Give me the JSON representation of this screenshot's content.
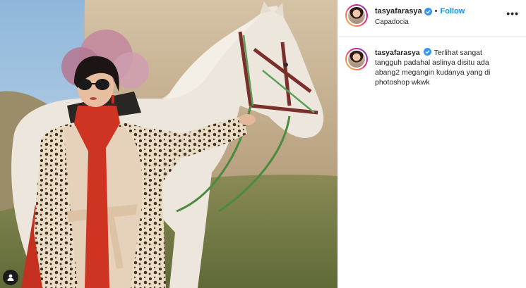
{
  "post": {
    "author": {
      "username": "tasyafarasya",
      "verified": true,
      "location": "Capadocia"
    },
    "follow_label": "Follow",
    "separator": "•",
    "more_label": "•••",
    "caption": {
      "username": "tasyafarasya",
      "text": "Terlihat sangat tangguh padahal aslinya disitu ada abang2 megangin kudanya yang di photoshop wkwk"
    },
    "photo_description_icons": [
      "user-tag-icon"
    ],
    "colors": {
      "accent": "#0095f6",
      "verified": "#3897f0",
      "text": "#262626",
      "divider": "#efefef"
    }
  }
}
